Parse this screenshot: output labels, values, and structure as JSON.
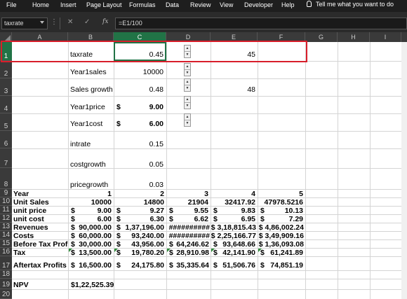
{
  "menu": [
    "File",
    "Home",
    "Insert",
    "Page Layout",
    "Formulas",
    "Data",
    "Review",
    "View",
    "Developer",
    "Help"
  ],
  "tellme": "Tell me what you want to do",
  "namebox": "taxrate",
  "formula": "=E1/100",
  "formula_icons": {
    "cancel": "✕",
    "enter": "✓",
    "fx": "fx"
  },
  "columns": [
    "A",
    "B",
    "C",
    "D",
    "E",
    "F",
    "G",
    "H",
    "I"
  ],
  "rows": [
    "1",
    "2",
    "3",
    "4",
    "5",
    "6",
    "7",
    "8",
    "9",
    "10",
    "11",
    "12",
    "13",
    "14",
    "15",
    "16",
    "17",
    "18",
    "19",
    "20"
  ],
  "cells": {
    "B1": "taxrate",
    "C1": "0.45",
    "E1": "45",
    "B2": "Year1sales",
    "C2": "10000",
    "B3": "Sales growth",
    "C3": "0.48",
    "E3": "48",
    "B4": "Year1price",
    "C4s": "$",
    "C4": "9.00",
    "B5": "Year1cost",
    "C5s": "$",
    "C5": "6.00",
    "B6": "intrate",
    "C6": "0.15",
    "B7": "costgrowth",
    "C7": "0.05",
    "B8": "pricegrowth",
    "C8": "0.03",
    "A9": "Year",
    "B9": "1",
    "C9": "2",
    "D9": "3",
    "E9": "4",
    "F9": "5",
    "A10": "Unit Sales",
    "B10": "10000",
    "C10": "14800",
    "D10": "21904",
    "E10": "32417.92",
    "F10": "47978.5216",
    "A11": "unit price",
    "B11s": "$",
    "B11": "9.00",
    "C11s": "$",
    "C11": "9.27",
    "D11s": "$",
    "D11": "9.55",
    "E11s": "$",
    "E11": "9.83",
    "F11s": "$",
    "F11": "10.13",
    "A12": "unit cost",
    "B12s": "$",
    "B12": "6.00",
    "C12s": "$",
    "C12": "6.30",
    "D12s": "$",
    "D12": "6.62",
    "E12s": "$",
    "E12": "6.95",
    "F12s": "$",
    "F12": "7.29",
    "A13": "Revenues",
    "B13s": "$",
    "B13": "90,000.00",
    "C13s": "$",
    "C13": "1,37,196.00",
    "D13": "##########",
    "E13": "$ 3,18,815.43",
    "F13": "$ 4,86,002.24",
    "A14": "Costs",
    "B14s": "$",
    "B14": "60,000.00",
    "C14s": "$",
    "C14": "93,240.00",
    "D14": "##########",
    "E14": "$ 2,25,166.77",
    "F14": "$ 3,49,909.16",
    "A15": "Before Tax Profit",
    "B15s": "$",
    "B15": "30,000.00",
    "C15s": "$",
    "C15": "43,956.00",
    "D15s": "$",
    "D15": "64,246.62",
    "E15s": "$",
    "E15": "93,648.66",
    "F15": "$ 1,36,093.08",
    "A16": "Tax",
    "B16s": "$",
    "B16": "13,500.00",
    "C16s": "$",
    "C16": "19,780.20",
    "D16s": "$",
    "D16": "28,910.98",
    "E16s": "$",
    "E16": "42,141.90",
    "F16s": "$",
    "F16": "61,241.89",
    "A17": "Aftertax Profits",
    "B17s": "$",
    "B17": "16,500.00",
    "C17s": "$",
    "C17": "24,175.80",
    "D17s": "$",
    "D17": "35,335.64",
    "E17s": "$",
    "E17": "51,506.76",
    "F17s": "$",
    "F17": "74,851.19",
    "A19": "NPV",
    "B19": "$1,22,525.39"
  },
  "colors": {
    "selection": "#217346",
    "highlight_box": "#d81e2b",
    "ribbon": "#1e1e1e"
  }
}
